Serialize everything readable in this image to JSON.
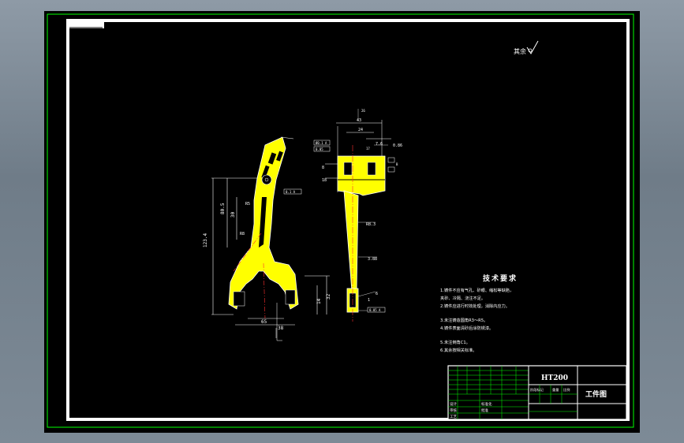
{
  "drawing": {
    "roughness_symbol_prefix": "其余",
    "title_block": {
      "material": "HT200",
      "drawing_name": "工件图",
      "row_labels": [
        "设计",
        "审核",
        "工艺"
      ],
      "header_labels": [
        "标准化",
        "批准"
      ],
      "scale_labels": [
        "阶段标记",
        "重量",
        "比例"
      ]
    },
    "technical_requirements": {
      "title": "技术要求",
      "items": [
        "1.铸件不应有气孔、砂眼、缩松等缺陷，",
        "夹砂、冷隔、浇注不足。",
        "2.铸件应进行时效处理，消除内应力。",
        "3.未注铸造圆角R3～R5。",
        "4.铸件表面清砂后涂防锈漆。",
        "5.未注倒角C1。",
        "6.其余按相关标准。"
      ]
    },
    "colors": {
      "part_fill": "#ffff00",
      "outline": "#ffffff",
      "frame": "#00ff00",
      "dimension": "#ffffff",
      "center_line": "#ff3030"
    }
  }
}
